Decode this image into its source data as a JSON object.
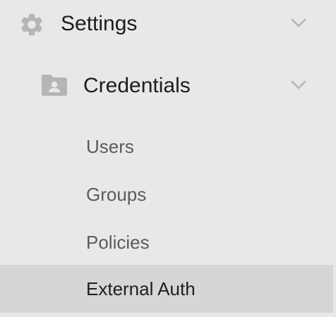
{
  "nav": {
    "settings": {
      "label": "Settings",
      "icon": "gear-icon",
      "expanded": true
    },
    "credentials": {
      "label": "Credentials",
      "icon": "folder-user-icon",
      "expanded": true
    },
    "items": [
      {
        "label": "Users"
      },
      {
        "label": "Groups"
      },
      {
        "label": "Policies"
      },
      {
        "label": "External Auth",
        "selected": true
      }
    ]
  },
  "colors": {
    "background": "#e8e8e8",
    "selected_background": "#d6d6d6",
    "icon": "#b5b5b5",
    "text_primary": "#1d1d1d",
    "text_secondary": "#5b5b5b"
  }
}
